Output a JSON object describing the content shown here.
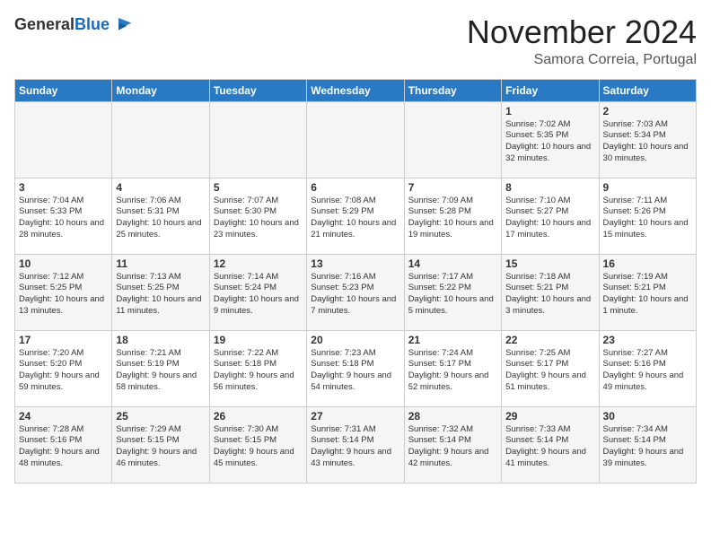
{
  "header": {
    "logo_general": "General",
    "logo_blue": "Blue",
    "month": "November 2024",
    "location": "Samora Correia, Portugal"
  },
  "days_of_week": [
    "Sunday",
    "Monday",
    "Tuesday",
    "Wednesday",
    "Thursday",
    "Friday",
    "Saturday"
  ],
  "weeks": [
    [
      {
        "num": "",
        "info": ""
      },
      {
        "num": "",
        "info": ""
      },
      {
        "num": "",
        "info": ""
      },
      {
        "num": "",
        "info": ""
      },
      {
        "num": "",
        "info": ""
      },
      {
        "num": "1",
        "info": "Sunrise: 7:02 AM\nSunset: 5:35 PM\nDaylight: 10 hours and 32 minutes."
      },
      {
        "num": "2",
        "info": "Sunrise: 7:03 AM\nSunset: 5:34 PM\nDaylight: 10 hours and 30 minutes."
      }
    ],
    [
      {
        "num": "3",
        "info": "Sunrise: 7:04 AM\nSunset: 5:33 PM\nDaylight: 10 hours and 28 minutes."
      },
      {
        "num": "4",
        "info": "Sunrise: 7:06 AM\nSunset: 5:31 PM\nDaylight: 10 hours and 25 minutes."
      },
      {
        "num": "5",
        "info": "Sunrise: 7:07 AM\nSunset: 5:30 PM\nDaylight: 10 hours and 23 minutes."
      },
      {
        "num": "6",
        "info": "Sunrise: 7:08 AM\nSunset: 5:29 PM\nDaylight: 10 hours and 21 minutes."
      },
      {
        "num": "7",
        "info": "Sunrise: 7:09 AM\nSunset: 5:28 PM\nDaylight: 10 hours and 19 minutes."
      },
      {
        "num": "8",
        "info": "Sunrise: 7:10 AM\nSunset: 5:27 PM\nDaylight: 10 hours and 17 minutes."
      },
      {
        "num": "9",
        "info": "Sunrise: 7:11 AM\nSunset: 5:26 PM\nDaylight: 10 hours and 15 minutes."
      }
    ],
    [
      {
        "num": "10",
        "info": "Sunrise: 7:12 AM\nSunset: 5:25 PM\nDaylight: 10 hours and 13 minutes."
      },
      {
        "num": "11",
        "info": "Sunrise: 7:13 AM\nSunset: 5:25 PM\nDaylight: 10 hours and 11 minutes."
      },
      {
        "num": "12",
        "info": "Sunrise: 7:14 AM\nSunset: 5:24 PM\nDaylight: 10 hours and 9 minutes."
      },
      {
        "num": "13",
        "info": "Sunrise: 7:16 AM\nSunset: 5:23 PM\nDaylight: 10 hours and 7 minutes."
      },
      {
        "num": "14",
        "info": "Sunrise: 7:17 AM\nSunset: 5:22 PM\nDaylight: 10 hours and 5 minutes."
      },
      {
        "num": "15",
        "info": "Sunrise: 7:18 AM\nSunset: 5:21 PM\nDaylight: 10 hours and 3 minutes."
      },
      {
        "num": "16",
        "info": "Sunrise: 7:19 AM\nSunset: 5:21 PM\nDaylight: 10 hours and 1 minute."
      }
    ],
    [
      {
        "num": "17",
        "info": "Sunrise: 7:20 AM\nSunset: 5:20 PM\nDaylight: 9 hours and 59 minutes."
      },
      {
        "num": "18",
        "info": "Sunrise: 7:21 AM\nSunset: 5:19 PM\nDaylight: 9 hours and 58 minutes."
      },
      {
        "num": "19",
        "info": "Sunrise: 7:22 AM\nSunset: 5:18 PM\nDaylight: 9 hours and 56 minutes."
      },
      {
        "num": "20",
        "info": "Sunrise: 7:23 AM\nSunset: 5:18 PM\nDaylight: 9 hours and 54 minutes."
      },
      {
        "num": "21",
        "info": "Sunrise: 7:24 AM\nSunset: 5:17 PM\nDaylight: 9 hours and 52 minutes."
      },
      {
        "num": "22",
        "info": "Sunrise: 7:25 AM\nSunset: 5:17 PM\nDaylight: 9 hours and 51 minutes."
      },
      {
        "num": "23",
        "info": "Sunrise: 7:27 AM\nSunset: 5:16 PM\nDaylight: 9 hours and 49 minutes."
      }
    ],
    [
      {
        "num": "24",
        "info": "Sunrise: 7:28 AM\nSunset: 5:16 PM\nDaylight: 9 hours and 48 minutes."
      },
      {
        "num": "25",
        "info": "Sunrise: 7:29 AM\nSunset: 5:15 PM\nDaylight: 9 hours and 46 minutes."
      },
      {
        "num": "26",
        "info": "Sunrise: 7:30 AM\nSunset: 5:15 PM\nDaylight: 9 hours and 45 minutes."
      },
      {
        "num": "27",
        "info": "Sunrise: 7:31 AM\nSunset: 5:14 PM\nDaylight: 9 hours and 43 minutes."
      },
      {
        "num": "28",
        "info": "Sunrise: 7:32 AM\nSunset: 5:14 PM\nDaylight: 9 hours and 42 minutes."
      },
      {
        "num": "29",
        "info": "Sunrise: 7:33 AM\nSunset: 5:14 PM\nDaylight: 9 hours and 41 minutes."
      },
      {
        "num": "30",
        "info": "Sunrise: 7:34 AM\nSunset: 5:14 PM\nDaylight: 9 hours and 39 minutes."
      }
    ]
  ]
}
